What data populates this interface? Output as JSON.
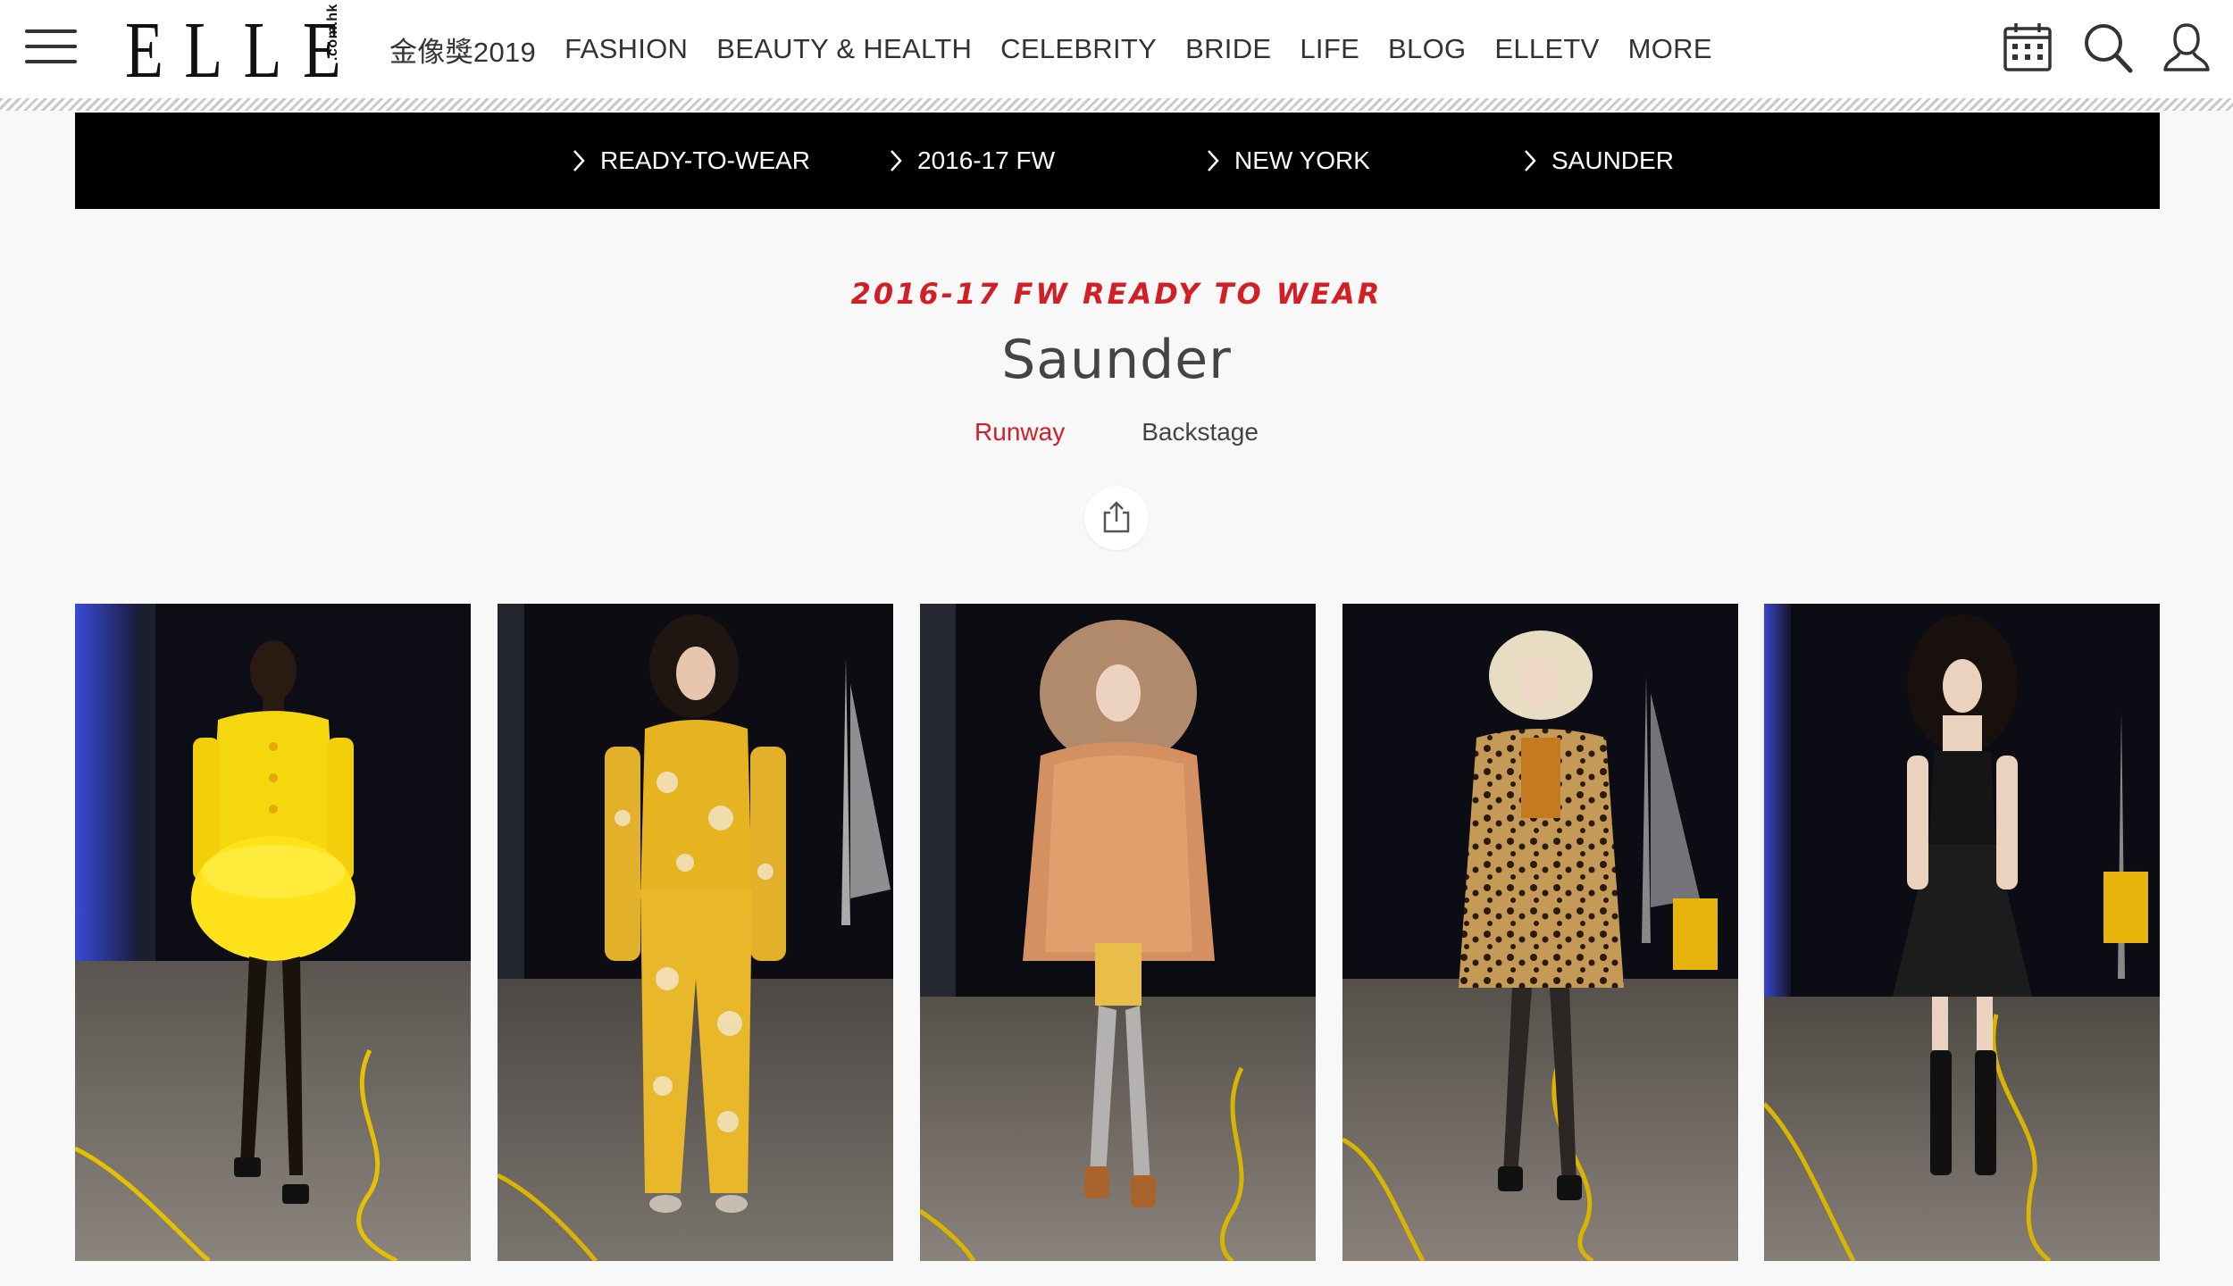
{
  "header": {
    "logo_text": "ELLE",
    "logo_sub": ".com.hk",
    "nav": [
      {
        "id": "golden-horse",
        "label": "金像獎2019"
      },
      {
        "id": "fashion",
        "label": "FASHION"
      },
      {
        "id": "beauty-health",
        "label": "BEAUTY & HEALTH"
      },
      {
        "id": "celebrity",
        "label": "CELEBRITY"
      },
      {
        "id": "bride",
        "label": "BRIDE"
      },
      {
        "id": "life",
        "label": "LIFE"
      },
      {
        "id": "blog",
        "label": "BLOG"
      },
      {
        "id": "elletv",
        "label": "ELLETV"
      },
      {
        "id": "more",
        "label": "MORE"
      }
    ],
    "icons": [
      "menu-icon",
      "calendar-icon",
      "search-icon",
      "user-icon"
    ]
  },
  "breadcrumb": [
    {
      "label": "READY-TO-WEAR"
    },
    {
      "label": "2016-17 FW"
    },
    {
      "label": "NEW YORK"
    },
    {
      "label": "SAUNDER"
    }
  ],
  "show": {
    "kicker": "2016-17 FW  READY TO WEAR",
    "title": "Saunder",
    "tabs": [
      {
        "label": "Runway",
        "active": true
      },
      {
        "label": "Backstage",
        "active": false
      }
    ],
    "share_icon": "share-icon"
  },
  "gallery": [
    {
      "look": "yellow-feather-dress"
    },
    {
      "look": "yellow-floral-suit"
    },
    {
      "look": "fox-fur-jacket"
    },
    {
      "look": "leopard-coat"
    },
    {
      "look": "black-leather-dress"
    }
  ],
  "colors": {
    "accent": "#d21f26",
    "crumbbar": "#000000",
    "page_bg": "#f8f8f8"
  }
}
